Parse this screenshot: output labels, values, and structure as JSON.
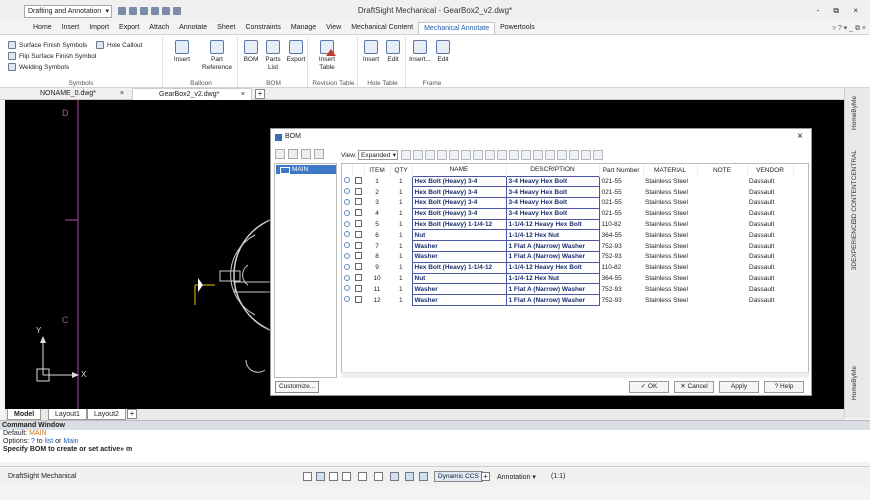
{
  "window": {
    "workspace": "Drafting and Annotation",
    "title": "DraftSight Mechanical - GearBox2_v2.dwg*",
    "controls": "- ⧉ ×"
  },
  "menu": {
    "items": [
      "Home",
      "Insert",
      "Import",
      "Export",
      "Attach",
      "Annotate",
      "Sheet",
      "Constraints",
      "Manage",
      "View",
      "Mechanical Content",
      "Mechanical Annotate",
      "Powertools"
    ],
    "active": "Mechanical Annotate",
    "right": "▿  ?  ▾ _ ⧉ ×"
  },
  "ribbon": {
    "symbols": {
      "items": [
        "Surface Finish Symbols",
        "Flip Surface Finish Symbol",
        "Welding Symbols",
        "Hole Callout"
      ],
      "label": "Symbols"
    },
    "balloon": {
      "items": [
        "Insert",
        "Part Reference"
      ],
      "label": "Balloon"
    },
    "bom": {
      "items": [
        "BOM",
        "Parts List",
        "Export"
      ],
      "label": "BOM"
    },
    "revision": {
      "items": [
        "Insert Table"
      ],
      "label": "Revision Table"
    },
    "hole_table": {
      "items": [
        "Insert",
        "Edit"
      ],
      "label": "Hole Table"
    },
    "frame": {
      "items": [
        "Insert...",
        "Edit"
      ],
      "label": "Frame"
    }
  },
  "doc_tabs": [
    {
      "label": "NONAME_0.dwg*",
      "close": "×"
    },
    {
      "label": "GearBox2_v2.dwg*",
      "close": "×"
    }
  ],
  "canvas": {
    "axis_y": "Y",
    "axis_x": "X",
    "label_d": "D",
    "label_c": "C"
  },
  "right_panel": [
    "HomeByMe",
    "3D CONTENTCENTRAL",
    "3DEXPERIENCE",
    "HomeByMe"
  ],
  "layout_tabs": [
    "Model",
    "Layout1",
    "Layout2"
  ],
  "command_window": {
    "title": "Command Window",
    "line1_prefix": "Default: ",
    "line1_value": "MAIN",
    "line2_prefix": "Options: ",
    "line2_opt1": "?",
    "line2_mid1": " to ",
    "line2_opt2": "list",
    "line2_mid2": " or ",
    "line2_opt3": "Main",
    "line3": "Specify BOM to create or set active» m"
  },
  "status_bar": {
    "app": "DraftSight Mechanical",
    "dynamic_ccs": "Dynamic CCS",
    "annotation": "Annotation",
    "scale": "(1:1)"
  },
  "bom": {
    "title": "BOM",
    "close": "×",
    "tree_root": "MAIN",
    "view_label": "View:",
    "view_value": "Expanded",
    "columns": [
      "ITEM",
      "QTY",
      "NAME",
      "DESCRIPTION",
      "Part Number",
      "MATERIAL",
      "NOTE",
      "VENDOR"
    ],
    "rows": [
      [
        "1",
        "1",
        "Hex Bolt (Heavy) 3-4",
        "3-4 Heavy Hex Bolt",
        "021-55",
        "Stainless Steel",
        "",
        "Dassault"
      ],
      [
        "2",
        "1",
        "Hex Bolt (Heavy) 3-4",
        "3-4 Heavy Hex Bolt",
        "021-55",
        "Stainless Steel",
        "",
        "Dassault"
      ],
      [
        "3",
        "1",
        "Hex Bolt (Heavy) 3-4",
        "3-4 Heavy Hex Bolt",
        "021-55",
        "Stainless Steel",
        "",
        "Dassault"
      ],
      [
        "4",
        "1",
        "Hex Bolt (Heavy) 3-4",
        "3-4 Heavy Hex Bolt",
        "021-55",
        "Stainless Steel",
        "",
        "Dassault"
      ],
      [
        "5",
        "1",
        "Hex Bolt (Heavy) 1-1/4-12",
        "1-1/4-12 Heavy Hex Bolt",
        "110-82",
        "Stainless Steel",
        "",
        "Dassault"
      ],
      [
        "6",
        "1",
        "Nut",
        "1-1/4-12 Hex Nut",
        "364-55",
        "Stainless Steel",
        "",
        "Dassault"
      ],
      [
        "7",
        "1",
        "Washer",
        "1 Flat A (Narrow) Washer",
        "752-93",
        "Stainless Steel",
        "",
        "Dassault"
      ],
      [
        "8",
        "1",
        "Washer",
        "1 Flat A (Narrow) Washer",
        "752-93",
        "Stainless Steel",
        "",
        "Dassault"
      ],
      [
        "9",
        "1",
        "Hex Bolt (Heavy) 1-1/4-12",
        "1-1/4-12 Heavy Hex Bolt",
        "110-82",
        "Stainless Steel",
        "",
        "Dassault"
      ],
      [
        "10",
        "1",
        "Nut",
        "1-1/4-12 Hex Nut",
        "364-55",
        "Stainless Steel",
        "",
        "Dassault"
      ],
      [
        "11",
        "1",
        "Washer",
        "1 Flat A (Narrow) Washer",
        "752-93",
        "Stainless Steel",
        "",
        "Dassault"
      ],
      [
        "12",
        "1",
        "Washer",
        "1 Flat A (Narrow) Washer",
        "752-93",
        "Stainless Steel",
        "",
        "Dassault"
      ]
    ],
    "customize": "Customize...",
    "ok": "✓ OK",
    "cancel": "✕ Cancel",
    "apply": "Apply",
    "help": "? Help"
  }
}
